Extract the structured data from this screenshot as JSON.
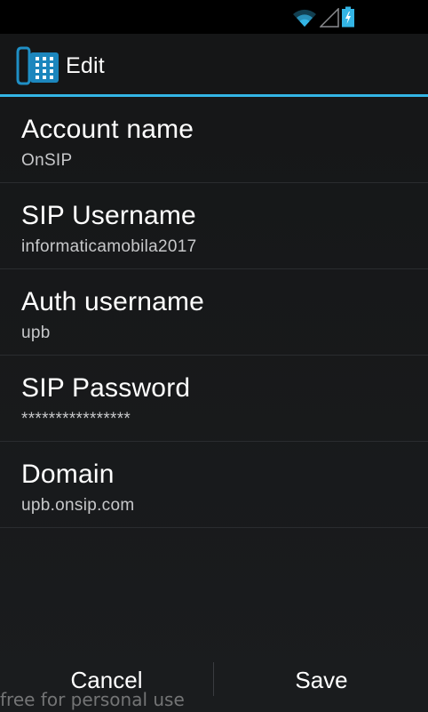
{
  "status_bar": {
    "icons": [
      "wifi-icon",
      "signal-icon",
      "battery-charging-icon"
    ],
    "accent": "#33b5e5"
  },
  "action_bar": {
    "icon": "phone-keypad-icon",
    "title": "Edit"
  },
  "preferences": [
    {
      "title": "Account name",
      "summary": "OnSIP"
    },
    {
      "title": "SIP Username",
      "summary": "informaticamobila2017"
    },
    {
      "title": "Auth username",
      "summary": "upb"
    },
    {
      "title": "SIP Password",
      "summary": "****************"
    },
    {
      "title": "Domain",
      "summary": "upb.onsip.com"
    }
  ],
  "buttons": {
    "cancel_label": "Cancel",
    "save_label": "Save"
  },
  "watermark": "free for personal use"
}
